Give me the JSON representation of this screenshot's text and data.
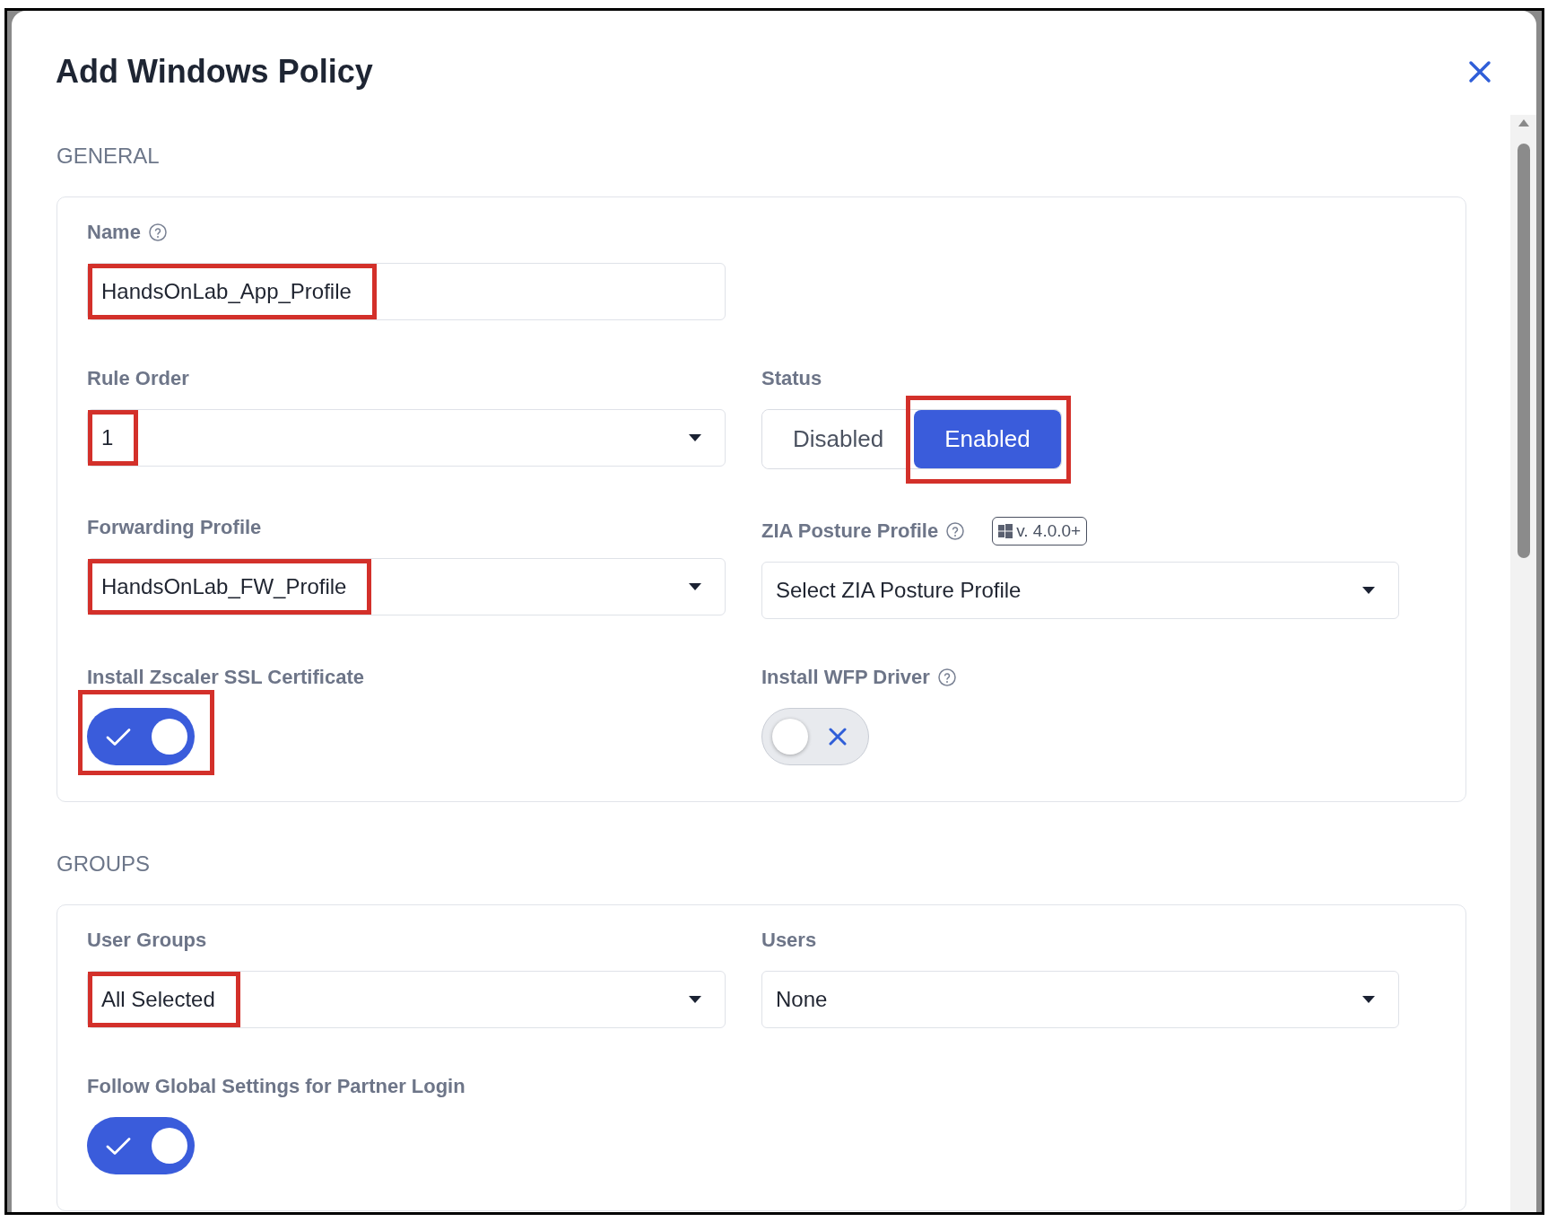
{
  "dialog": {
    "title": "Add Windows Policy"
  },
  "sections": [
    {
      "title": "GENERAL",
      "rows": [
        [
          {
            "kind": "text",
            "label": "Name",
            "help": true,
            "value": "HandsOnLab_App_Profile",
            "highlighted": true
          }
        ],
        [
          {
            "kind": "select",
            "label": "Rule Order",
            "value": "1",
            "highlighted": true
          },
          {
            "kind": "segmented",
            "label": "Status",
            "options": [
              {
                "label": "Disabled",
                "selected": false
              },
              {
                "label": "Enabled",
                "selected": true,
                "highlighted": true
              }
            ]
          }
        ],
        [
          {
            "kind": "select",
            "label": "Forwarding Profile",
            "value": "HandsOnLab_FW_Profile",
            "highlighted": true
          },
          {
            "kind": "select",
            "label": "ZIA Posture Profile",
            "help": true,
            "badge": "v. 4.0.0+",
            "placeholder": "Select ZIA Posture Profile"
          }
        ],
        [
          {
            "kind": "toggle",
            "label": "Install Zscaler SSL Certificate",
            "on": true,
            "highlighted": true
          },
          {
            "kind": "toggle",
            "label": "Install WFP Driver",
            "help": true,
            "on": false
          }
        ]
      ]
    },
    {
      "title": "GROUPS",
      "rows": [
        [
          {
            "kind": "select",
            "label": "User Groups",
            "value": "All Selected",
            "highlighted": true
          },
          {
            "kind": "select",
            "label": "Users",
            "value": "None"
          }
        ],
        [
          {
            "kind": "toggle",
            "label": "Follow Global Settings for Partner Login",
            "on": true
          }
        ]
      ]
    }
  ]
}
